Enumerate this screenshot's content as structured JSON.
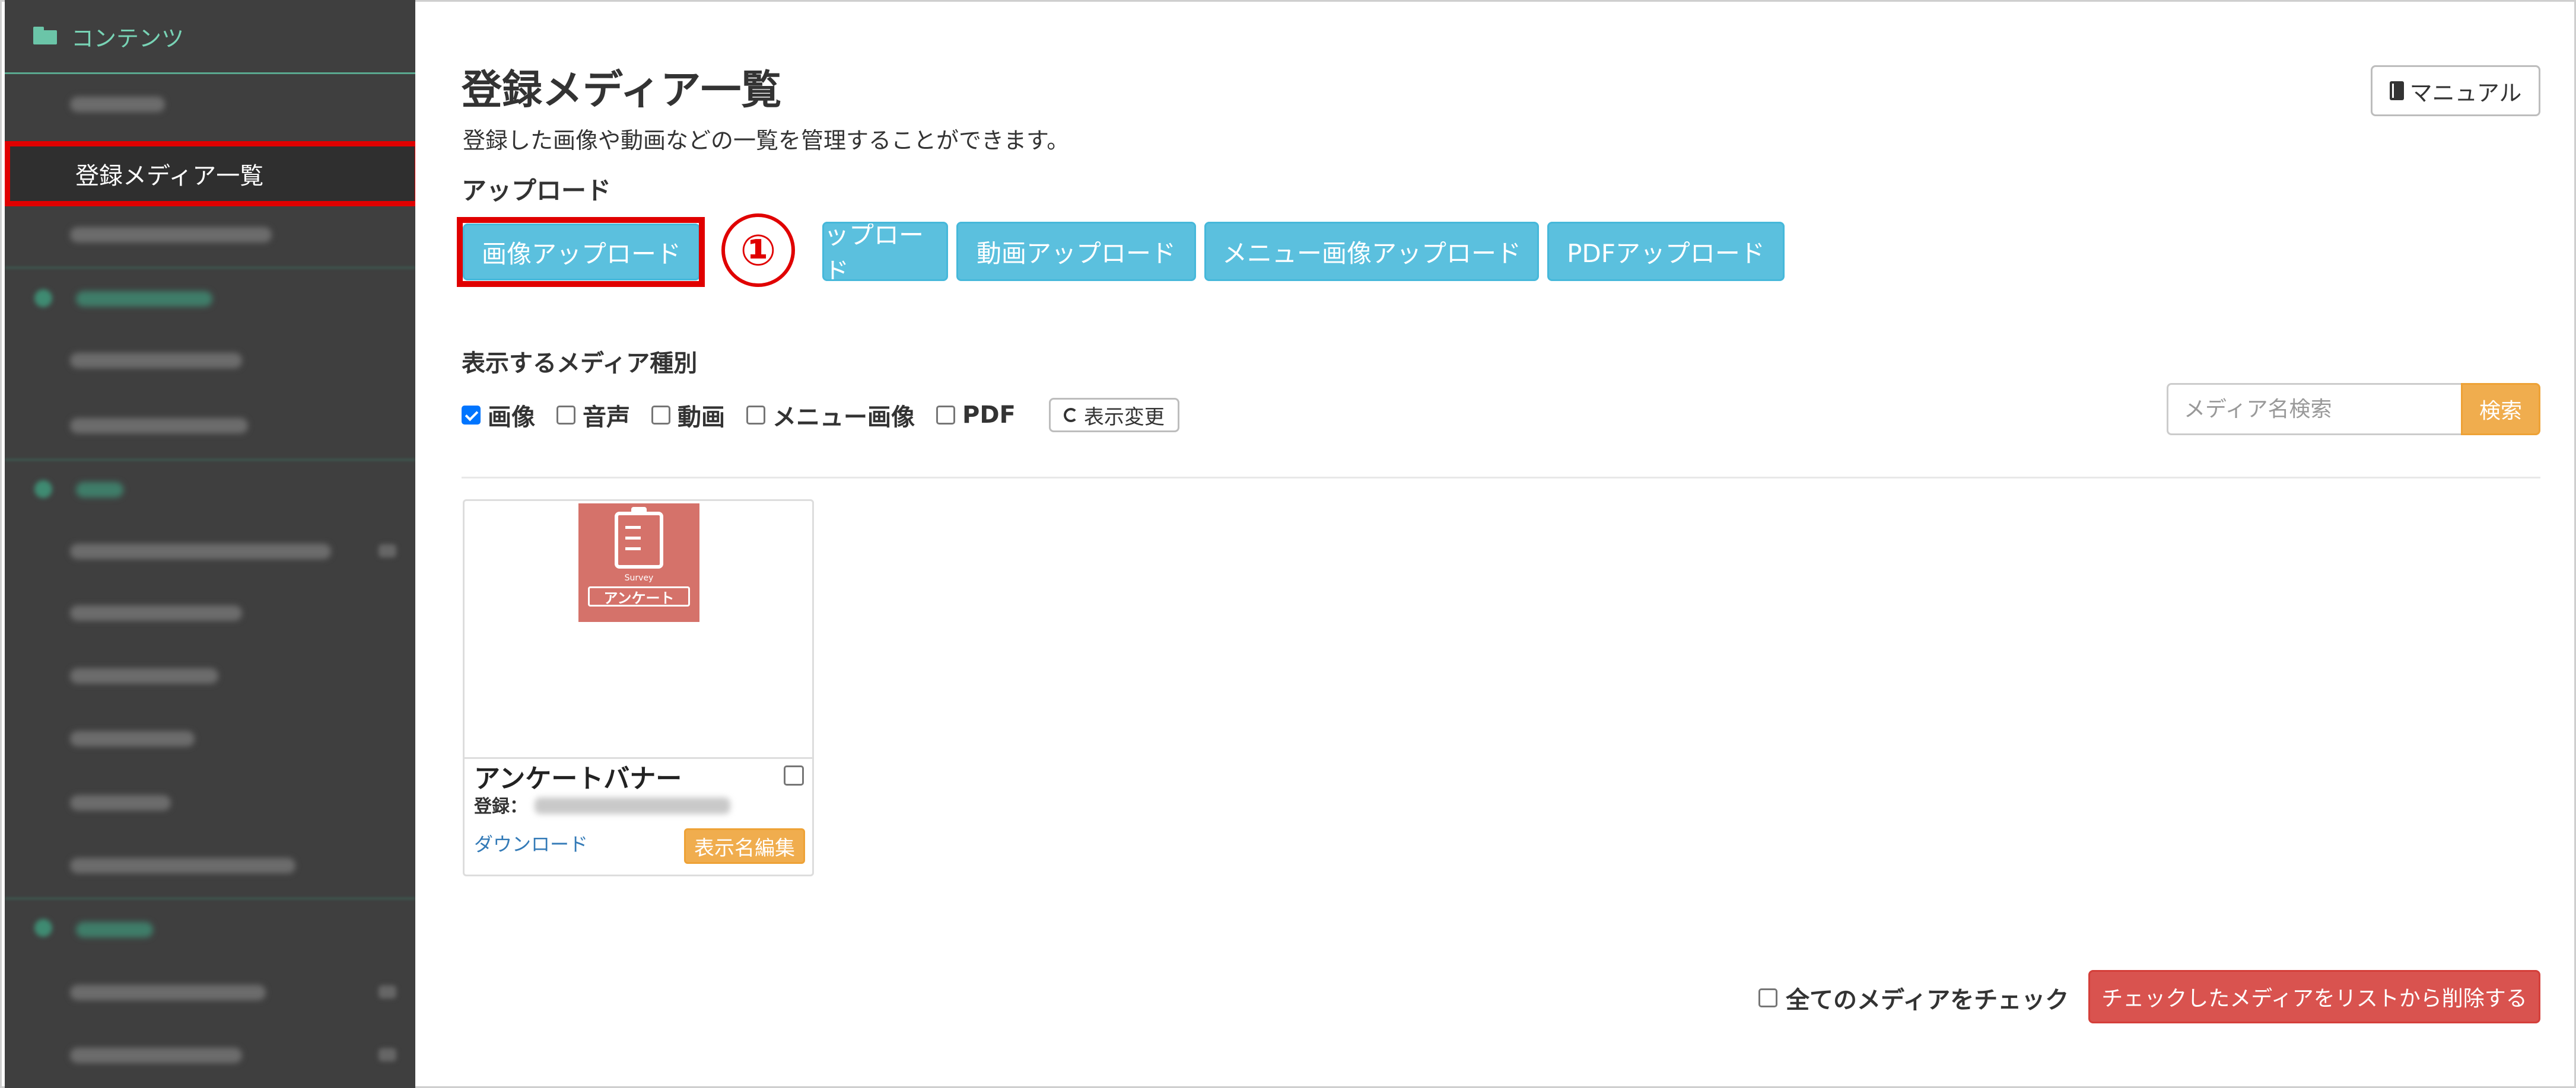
{
  "sidebar": {
    "header": "コンテンツ",
    "active_item": "登録メディア一覧"
  },
  "page": {
    "title": "登録メディア一覧",
    "subtitle": "登録した画像や動画などの一覧を管理することができます。",
    "manual_label": "マニュアル"
  },
  "upload": {
    "heading": "アップロード",
    "buttons": {
      "image": "画像アップロード",
      "audio": "ップロード",
      "video": "動画アップロード",
      "menu_image": "メニュー画像アップロード",
      "pdf": "PDFアップロード"
    },
    "marker": "①"
  },
  "media_types": {
    "heading": "表示するメディア種別",
    "image": {
      "label": "画像",
      "checked": true
    },
    "audio": {
      "label": "音声",
      "checked": false
    },
    "video": {
      "label": "動画",
      "checked": false
    },
    "menu_image": {
      "label": "メニュー画像",
      "checked": false
    },
    "pdf": {
      "label": "PDF",
      "checked": false
    },
    "refresh_label": "表示変更"
  },
  "search": {
    "placeholder": "メディア名検索",
    "button": "検索"
  },
  "media": [
    {
      "name": "アンケートバナー",
      "registered_label": "登録：",
      "thumb_caption": "Survey",
      "thumb_tag": "アンケート",
      "download": "ダウンロード",
      "edit": "表示名編集"
    }
  ],
  "bottom": {
    "check_all": "全てのメディアをチェック",
    "delete": "チェックしたメディアをリストから削除する"
  },
  "colors": {
    "info": "#5bc0de",
    "warning": "#f0ad4e",
    "danger": "#d9534f",
    "highlight": "#e00000",
    "sidebar": "#3f3f3f",
    "sidebar_accent": "#78d3b5"
  }
}
